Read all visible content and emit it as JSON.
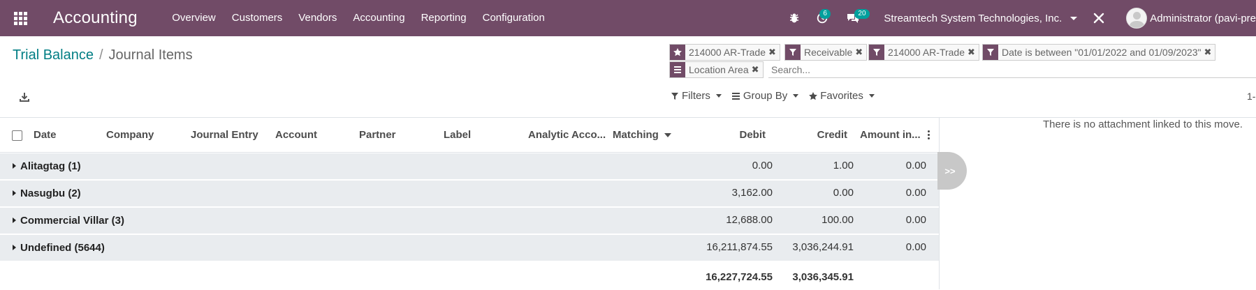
{
  "navbar": {
    "app_name": "Accounting",
    "menu": [
      "Overview",
      "Customers",
      "Vendors",
      "Accounting",
      "Reporting",
      "Configuration"
    ],
    "activity_count": "6",
    "message_count": "20",
    "company": "Streamtech System Technologies, Inc.",
    "user": "Administrator (pavi-pre",
    "brand_color": "#714B67"
  },
  "breadcrumb": {
    "parent": "Trial Balance",
    "separator": "/",
    "current": "Journal Items"
  },
  "search": {
    "facets": [
      {
        "icon": "star-icon",
        "value": "214000 AR-Trade"
      },
      {
        "icon": "filter-icon",
        "value": "Receivable"
      },
      {
        "icon": "filter-icon",
        "value": "214000 AR-Trade"
      },
      {
        "icon": "filter-icon",
        "value": "Date is between \"01/01/2022 and 01/09/2023\""
      },
      {
        "icon": "groupby-icon",
        "value": "Location Area"
      }
    ],
    "placeholder": "Search...",
    "filters_label": "Filters",
    "groupby_label": "Group By",
    "favorites_label": "Favorites",
    "pager": "1-"
  },
  "table": {
    "headers": {
      "date": "Date",
      "company": "Company",
      "journal_entry": "Journal Entry",
      "account": "Account",
      "partner": "Partner",
      "label": "Label",
      "analytic": "Analytic Acco...",
      "matching": "Matching",
      "debit": "Debit",
      "credit": "Credit",
      "amount": "Amount in..."
    },
    "groups": [
      {
        "name": "Alitagtag (1)",
        "debit": "0.00",
        "credit": "1.00",
        "amount": "0.00"
      },
      {
        "name": "Nasugbu (2)",
        "debit": "3,162.00",
        "credit": "0.00",
        "amount": "0.00"
      },
      {
        "name": "Commercial Villar (3)",
        "debit": "12,688.00",
        "credit": "100.00",
        "amount": "0.00"
      },
      {
        "name": "Undefined (5644)",
        "debit": "16,211,874.55",
        "credit": "3,036,244.91",
        "amount": "0.00"
      }
    ],
    "totals": {
      "debit": "16,227,724.55",
      "credit": "3,036,345.91"
    }
  },
  "chatter": {
    "message": "There is no attachment linked to this move.",
    "toggle": ">>"
  }
}
